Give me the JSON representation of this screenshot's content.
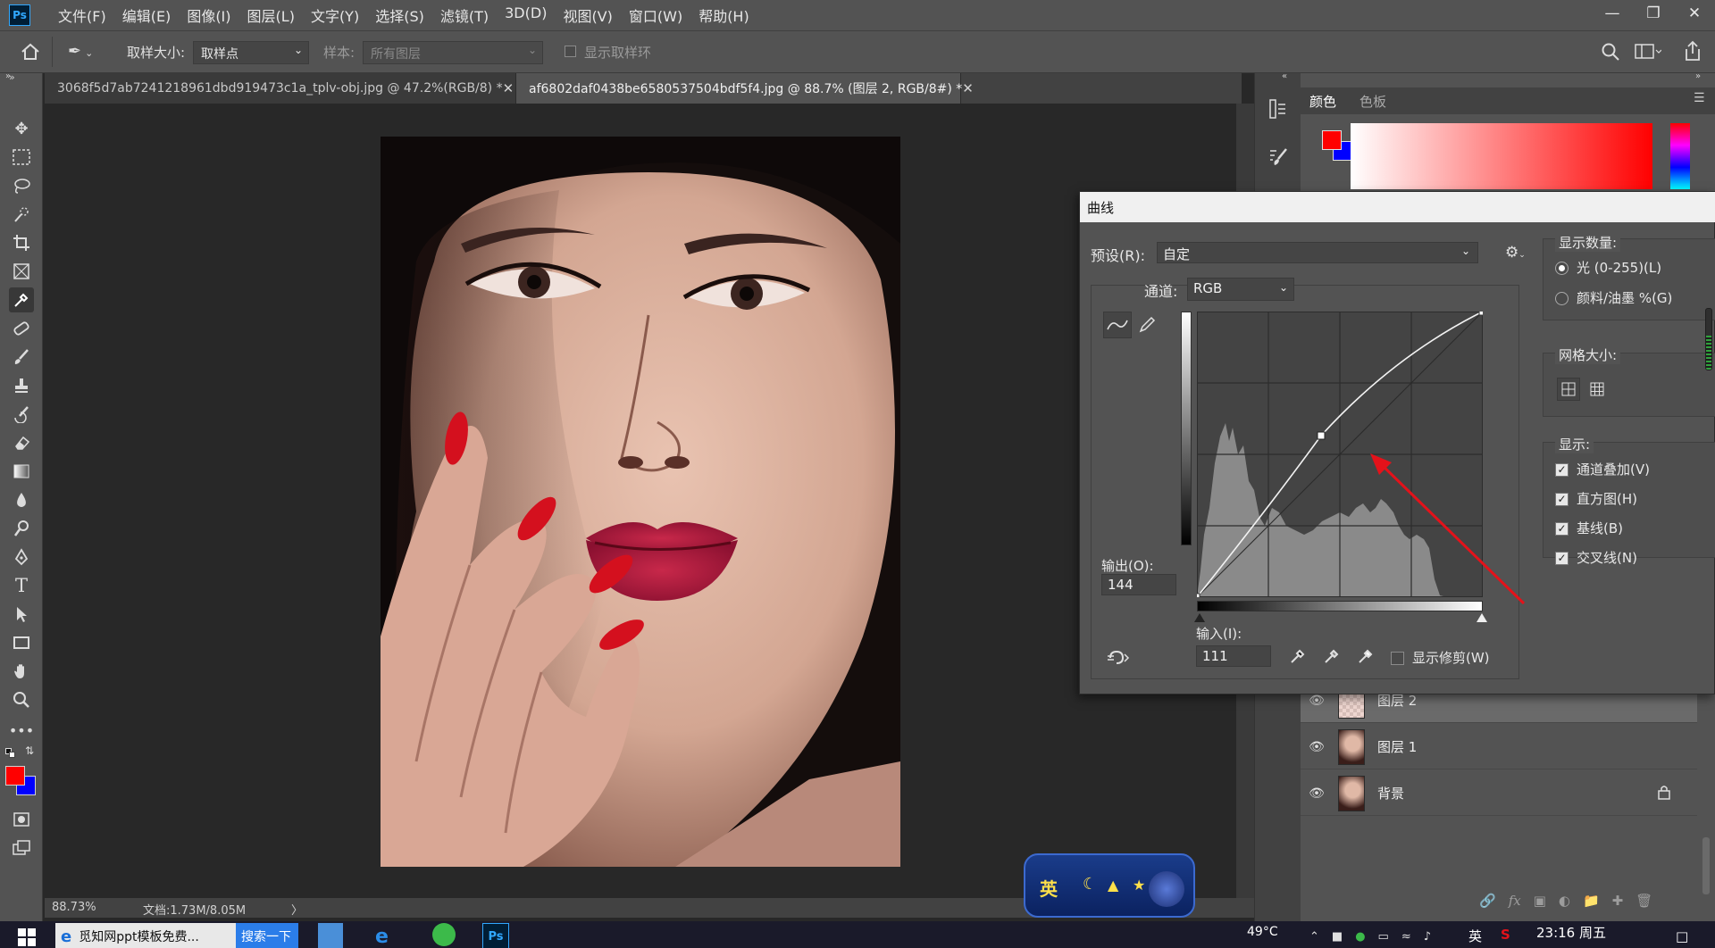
{
  "app": {
    "logo": "Ps",
    "menu": [
      "文件(F)",
      "编辑(E)",
      "图像(I)",
      "图层(L)",
      "文字(Y)",
      "选择(S)",
      "滤镜(T)",
      "3D(D)",
      "视图(V)",
      "窗口(W)",
      "帮助(H)"
    ]
  },
  "options_bar": {
    "sample_size_label": "取样大小:",
    "sample_size_value": "取样点",
    "sample_label": "样本:",
    "sample_value": "所有图层",
    "show_ring_label": "显示取样环"
  },
  "tabs": [
    {
      "title": "3068f5d7ab7241218961dbd919473c1a_tplv-obj.jpg @ 47.2%(RGB/8) *",
      "active": false
    },
    {
      "title": "af6802daf0438be6580537504bdf5f4.jpg  @ 88.7% (图层 2, RGB/8#) *",
      "active": true
    }
  ],
  "status": {
    "zoom": "88.73%",
    "doc": "文档:1.73M/8.05M",
    "arrow": "〉"
  },
  "color_panel": {
    "tabs": [
      "颜色",
      "色板"
    ],
    "fg_color": "#ff0000",
    "bg_color": "#0000ff"
  },
  "layers": [
    {
      "name": "图层 2",
      "selected": true
    },
    {
      "name": "图层 1",
      "selected": false
    },
    {
      "name": "背景",
      "selected": false,
      "locked": true
    }
  ],
  "curves": {
    "title": "曲线",
    "preset_label": "预设(R):",
    "preset_value": "自定",
    "channel_label": "通道:",
    "channel_value": "RGB",
    "output_label": "输出(O):",
    "output_value": "144",
    "input_label": "输入(I):",
    "input_value": "111",
    "show_clipping_label": "显示修剪(W)",
    "show_amount_title": "显示数量:",
    "amount_light": "光 (0-255)(L)",
    "amount_pigment": "颜料/油墨 %(G)",
    "grid_size_title": "网格大小:",
    "show_title": "显示:",
    "show_options": [
      {
        "label": "通道叠加(V)",
        "checked": true
      },
      {
        "label": "直方图(H)",
        "checked": true
      },
      {
        "label": "基线(B)",
        "checked": true
      },
      {
        "label": "交叉线(N)",
        "checked": true
      }
    ]
  },
  "ime": {
    "label": "英"
  },
  "taskbar": {
    "ie_app": "觅知网ppt模板免费...",
    "search": "搜索一下",
    "temp": "49°C",
    "ime_lang": "英",
    "time": "23:16 周五"
  }
}
